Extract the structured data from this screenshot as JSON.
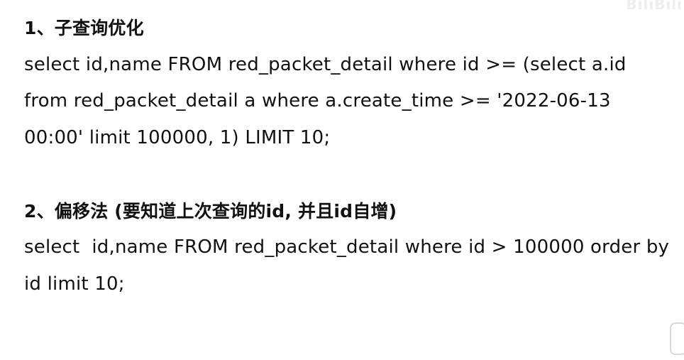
{
  "watermark": "BiliBili",
  "sections": [
    {
      "heading": "1、子查询优化",
      "lines": [
        "select id,name FROM red_packet_detail where id >= (select a.id",
        "from red_packet_detail a where a.create_time >= '2022-06-13",
        "00:00' limit 100000, 1) LIMIT 10;"
      ]
    },
    {
      "heading": "2、偏移法 (要知道上次查询的id, 并且id自增)",
      "lines": [
        "select  id,name FROM red_packet_detail where id > 100000 order by",
        "id limit 10;"
      ]
    }
  ]
}
